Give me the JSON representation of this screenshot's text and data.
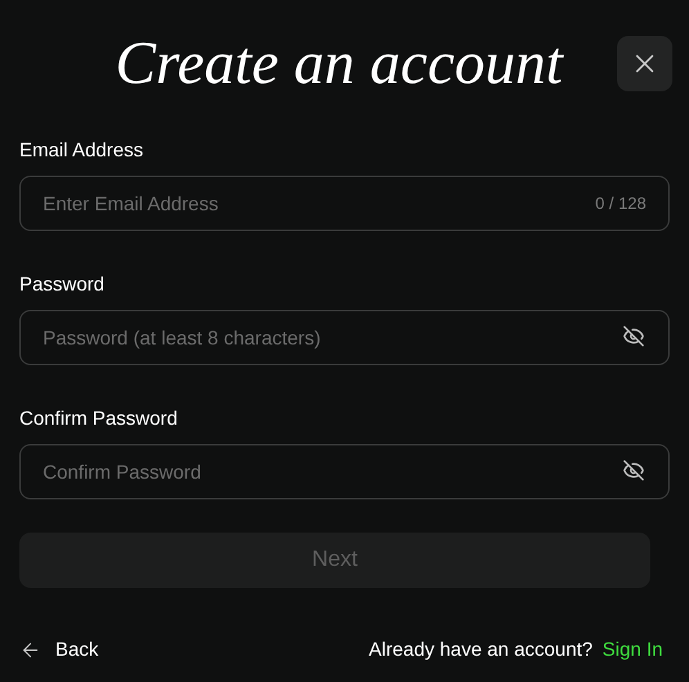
{
  "title": "Create an account",
  "fields": [
    {
      "kind": "email",
      "label": "Email Address",
      "placeholder": "Enter Email Address",
      "counter": "0 / 128"
    },
    {
      "kind": "password",
      "label": "Password",
      "placeholder": "Password (at least 8 characters)"
    },
    {
      "kind": "password",
      "label": "Confirm Password",
      "placeholder": "Confirm Password"
    }
  ],
  "next_button": {
    "label": "Next",
    "disabled": true
  },
  "back_link": "Back",
  "sign_in_prompt": "Already have an account?",
  "sign_in_link": "Sign In"
}
